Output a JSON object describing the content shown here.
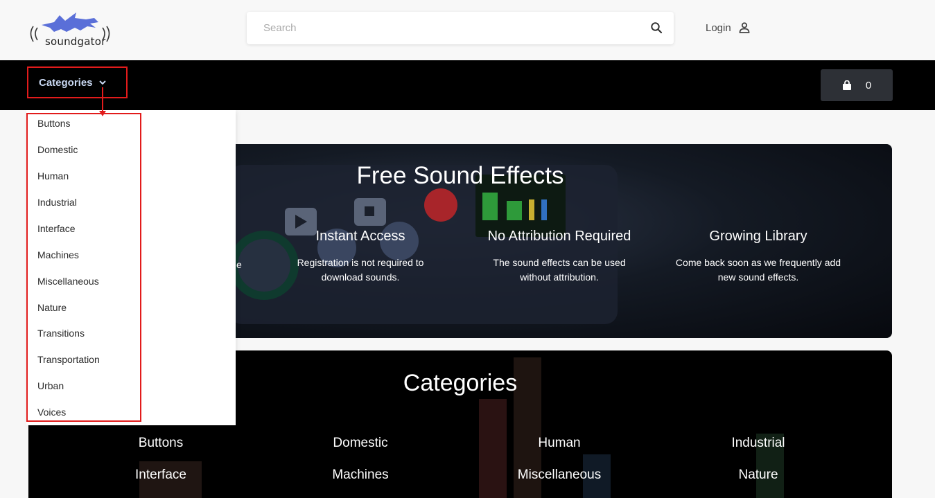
{
  "brand": {
    "name": "soundgator",
    "logo_color": "#5a6fd8"
  },
  "search": {
    "placeholder": "Search"
  },
  "header": {
    "login_label": "Login"
  },
  "nav": {
    "categories_label": "Categories",
    "cart_count": "0"
  },
  "dropdown": {
    "items": [
      "Buttons",
      "Domestic",
      "Human",
      "Industrial",
      "Interface",
      "Machines",
      "Miscellaneous",
      "Nature",
      "Transitions",
      "Transportation",
      "Urban",
      "Voices"
    ]
  },
  "hero": {
    "title": "Free Sound Effects",
    "features": [
      {
        "title": "Instant Access",
        "text_line1": "Registration is not required to",
        "text_line2": "download sounds."
      },
      {
        "title": "No Attribution Required",
        "text_line1": "The sound effects can be used",
        "text_line2": "without attribution."
      },
      {
        "title": "Growing Library",
        "text_line1": "Come back soon as we frequently add",
        "text_line2": "new sound effects."
      }
    ],
    "partial_text": "e"
  },
  "categories_section": {
    "title": "Categories",
    "items": [
      "Buttons",
      "Domestic",
      "Human",
      "Industrial",
      "Interface",
      "Machines",
      "Miscellaneous",
      "Nature"
    ]
  },
  "colors": {
    "annotation_red": "#e21b1b",
    "nav_bg": "#000000",
    "cart_bg": "#2d3036"
  }
}
